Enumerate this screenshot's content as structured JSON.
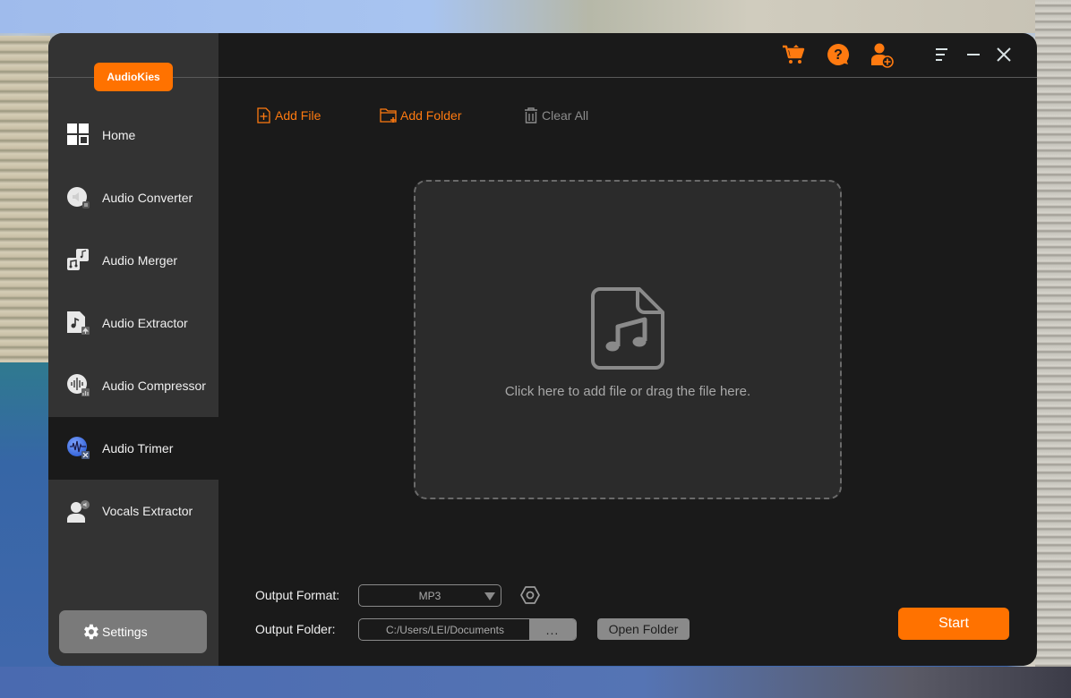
{
  "app": {
    "logo": "AudioKies"
  },
  "sidebar": {
    "items": [
      {
        "label": "Home",
        "icon": "home-grid-icon",
        "active": false
      },
      {
        "label": "Audio Converter",
        "icon": "audio-converter-icon",
        "active": false
      },
      {
        "label": "Audio Merger",
        "icon": "audio-merger-icon",
        "active": false
      },
      {
        "label": "Audio Extractor",
        "icon": "audio-extractor-icon",
        "active": false
      },
      {
        "label": "Audio Compressor",
        "icon": "audio-compressor-icon",
        "active": false
      },
      {
        "label": "Audio Trimer",
        "icon": "audio-trimmer-icon",
        "active": true
      },
      {
        "label": "Vocals Extractor",
        "icon": "vocals-extractor-icon",
        "active": false
      }
    ],
    "settings_label": "Settings"
  },
  "topbar": {
    "icons": [
      "cart-icon",
      "help-icon",
      "user-add-icon",
      "menu-icon",
      "minimize-icon",
      "close-icon"
    ]
  },
  "toolbar": {
    "add_file": "Add File",
    "add_folder": "Add Folder",
    "clear_all": "Clear All"
  },
  "dropzone": {
    "text": "Click here to add file or drag the file here."
  },
  "output": {
    "format_label": "Output Format:",
    "format_value": "MP3",
    "folder_label": "Output Folder:",
    "folder_value": "C:/Users/LEI/Documents",
    "browse_label": "...",
    "open_folder_label": "Open Folder",
    "start_label": "Start"
  },
  "colors": {
    "accent": "#ff7200",
    "sidebar_bg": "#333333",
    "main_bg": "#1a1a1a"
  }
}
